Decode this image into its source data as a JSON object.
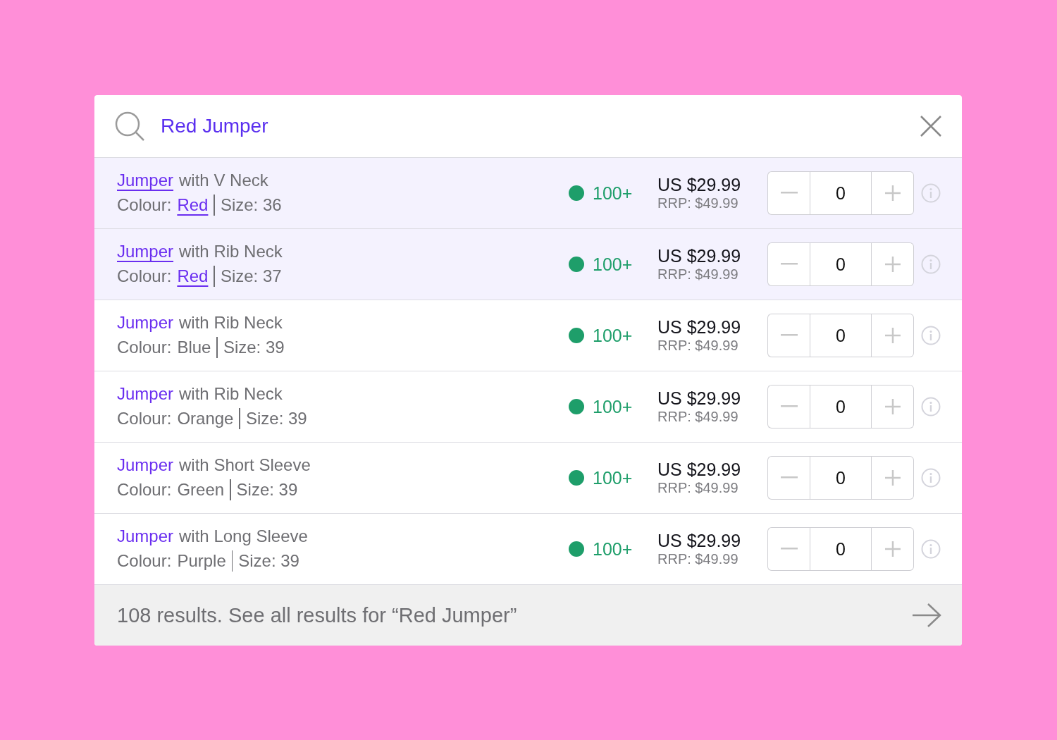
{
  "search": {
    "value": "Red Jumper"
  },
  "results": [
    {
      "match": "Jumper",
      "rest": "with V Neck",
      "colour_label": "Colour:",
      "colour": "Red",
      "size": "Size: 36",
      "highlighted": true,
      "stock": "100+",
      "price": "US $29.99",
      "rrp": "RRP: $49.99",
      "quantity": "0"
    },
    {
      "match": "Jumper",
      "rest": "with Rib Neck",
      "colour_label": "Colour:",
      "colour": "Red",
      "size": "Size: 37",
      "highlighted": true,
      "stock": "100+",
      "price": "US $29.99",
      "rrp": "RRP: $49.99",
      "quantity": "0"
    },
    {
      "match": "Jumper",
      "rest": "with Rib Neck",
      "colour_label": "Colour:",
      "colour": "Blue",
      "size": "Size: 39",
      "highlighted": false,
      "stock": "100+",
      "price": "US $29.99",
      "rrp": "RRP: $49.99",
      "quantity": "0"
    },
    {
      "match": "Jumper",
      "rest": "with Rib Neck",
      "colour_label": "Colour:",
      "colour": "Orange",
      "size": "Size: 39",
      "highlighted": false,
      "stock": "100+",
      "price": "US $29.99",
      "rrp": "RRP: $49.99",
      "quantity": "0"
    },
    {
      "match": "Jumper",
      "rest": "with Short Sleeve",
      "colour_label": "Colour:",
      "colour": "Green",
      "size": "Size: 39",
      "highlighted": false,
      "stock": "100+",
      "price": "US $29.99",
      "rrp": "RRP: $49.99",
      "quantity": "0"
    },
    {
      "match": "Jumper",
      "rest": "with Long Sleeve",
      "colour_label": "Colour:",
      "colour": "Purple",
      "size": "Size: 39",
      "highlighted": false,
      "stock": "100+",
      "price": "US $29.99",
      "rrp": "RRP: $49.99",
      "quantity": "0"
    }
  ],
  "footer": {
    "text": "108 results. See all results for “Red Jumper”"
  }
}
